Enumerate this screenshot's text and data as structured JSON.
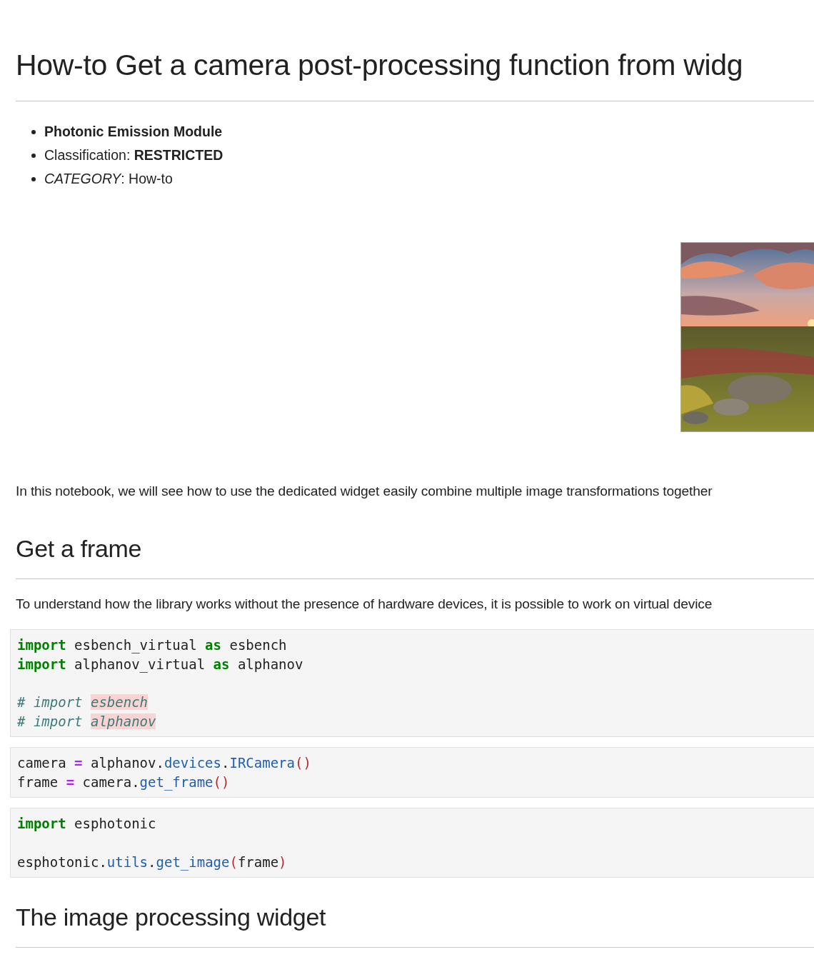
{
  "title": "How-to Get a camera post-processing function from widg",
  "meta_list": [
    {
      "text": "Photonic Emission Module",
      "bold": true
    },
    {
      "text": "Classification: **RESTRICTED**",
      "bold": false
    },
    {
      "text": "*CATEGORY*: How-to",
      "bold": false
    }
  ],
  "intro": "In this notebook, we will see how to use the dedicated widget easily combine multiple image transformations together",
  "sections": [
    {
      "heading": "Get a frame",
      "paragraph": "To understand how the library works without the presence of hardware devices, it is possible to work on virtual device",
      "code_cells": [
        {
          "groups": [
            [
              [
                {
                  "kind": "keyword",
                  "text": "import"
                },
                {
                  "kind": "plain",
                  "text": " esbench_virtual "
                },
                {
                  "kind": "keyword",
                  "text": "as"
                },
                {
                  "kind": "plain",
                  "text": " esbench"
                }
              ],
              [
                {
                  "kind": "keyword",
                  "text": "import"
                },
                {
                  "kind": "plain",
                  "text": " alphanov_virtual "
                },
                {
                  "kind": "keyword",
                  "text": "as"
                },
                {
                  "kind": "plain",
                  "text": " alphanov"
                }
              ]
            ],
            [
              [
                {
                  "kind": "comment",
                  "text": "# import "
                },
                {
                  "kind": "comment-error",
                  "text": "esbench"
                }
              ],
              [
                {
                  "kind": "comment",
                  "text": "# import "
                },
                {
                  "kind": "comment-error",
                  "text": "alphanov"
                }
              ]
            ]
          ]
        },
        {
          "groups": [
            [
              [
                {
                  "kind": "plain",
                  "text": "camera "
                },
                {
                  "kind": "operator",
                  "text": "="
                },
                {
                  "kind": "plain",
                  "text": " alphanov."
                },
                {
                  "kind": "attribute",
                  "text": "devices"
                },
                {
                  "kind": "plain",
                  "text": "."
                },
                {
                  "kind": "attribute",
                  "text": "IRCamera"
                },
                {
                  "kind": "paren",
                  "text": "()"
                }
              ],
              [
                {
                  "kind": "plain",
                  "text": "frame "
                },
                {
                  "kind": "operator",
                  "text": "="
                },
                {
                  "kind": "plain",
                  "text": " camera."
                },
                {
                  "kind": "attribute",
                  "text": "get_frame"
                },
                {
                  "kind": "paren",
                  "text": "()"
                }
              ]
            ]
          ]
        },
        {
          "groups": [
            [
              [
                {
                  "kind": "keyword",
                  "text": "import"
                },
                {
                  "kind": "plain",
                  "text": " esphotonic"
                }
              ]
            ],
            [
              [
                {
                  "kind": "plain",
                  "text": "esphotonic."
                },
                {
                  "kind": "attribute",
                  "text": "utils"
                },
                {
                  "kind": "plain",
                  "text": "."
                },
                {
                  "kind": "attribute",
                  "text": "get_image"
                },
                {
                  "kind": "paren",
                  "text": "("
                },
                {
                  "kind": "plain",
                  "text": "frame"
                },
                {
                  "kind": "paren",
                  "text": ")"
                }
              ]
            ]
          ]
        }
      ]
    },
    {
      "heading": "The image processing widget"
    }
  ]
}
